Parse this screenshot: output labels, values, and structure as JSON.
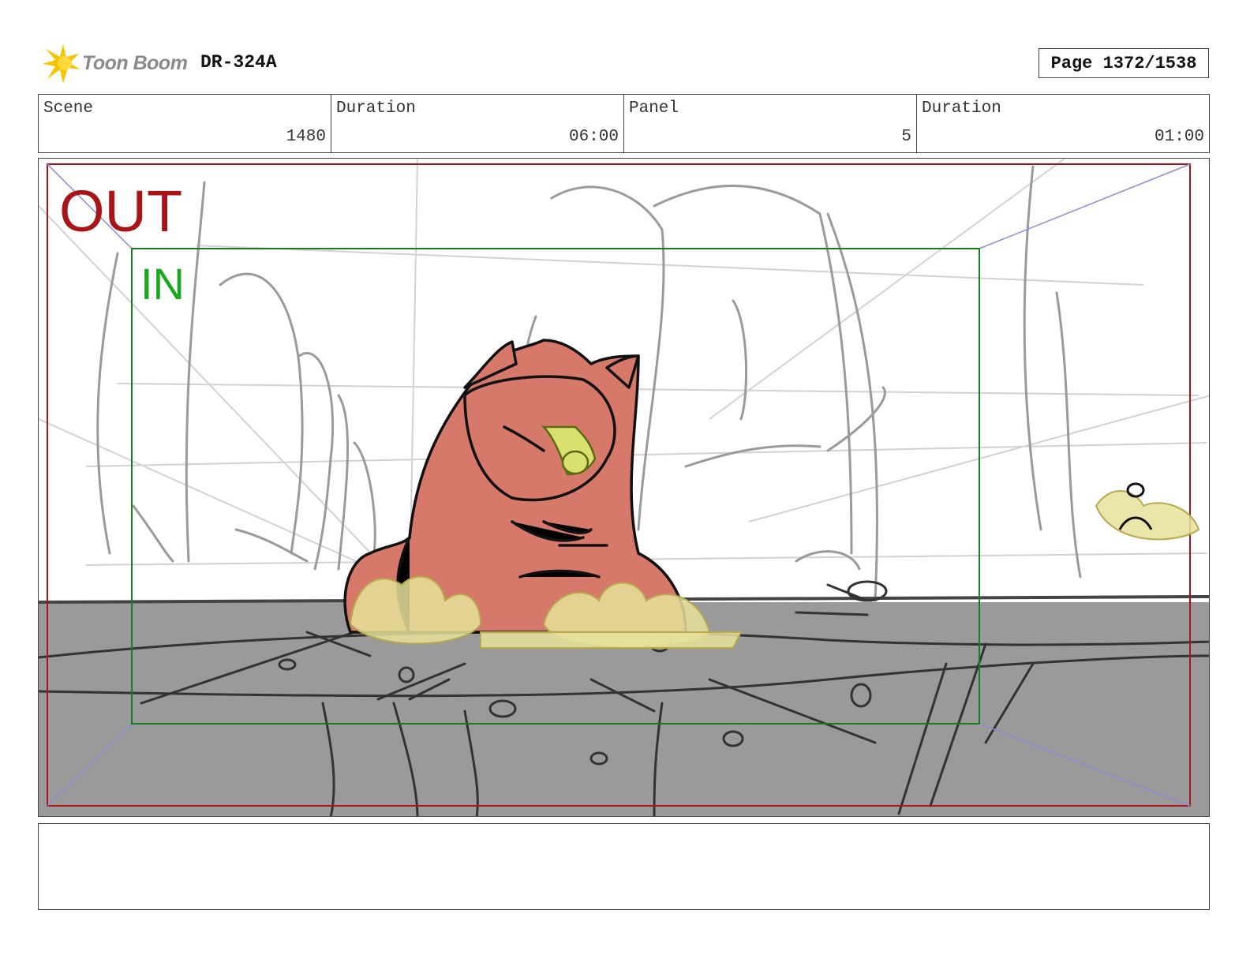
{
  "header": {
    "logo_text": "Toon Boom",
    "logo_icon": "starburst-logo-icon",
    "production_code": "DR-324A",
    "page": "Page 1372/1538"
  },
  "info": [
    {
      "label": "Scene",
      "value": "1480"
    },
    {
      "label": "Duration",
      "value": "06:00"
    },
    {
      "label": "Panel",
      "value": "5"
    },
    {
      "label": "Duration",
      "value": "01:00"
    }
  ],
  "panel": {
    "out_label": "OUT",
    "in_label": "IN",
    "colors": {
      "out_frame": "#a81418",
      "in_frame": "#1a7a1f",
      "ground": "#9a9a9a",
      "character": "#d6786a",
      "dust": "#e6e29a"
    }
  },
  "notes": {
    "text": ""
  }
}
